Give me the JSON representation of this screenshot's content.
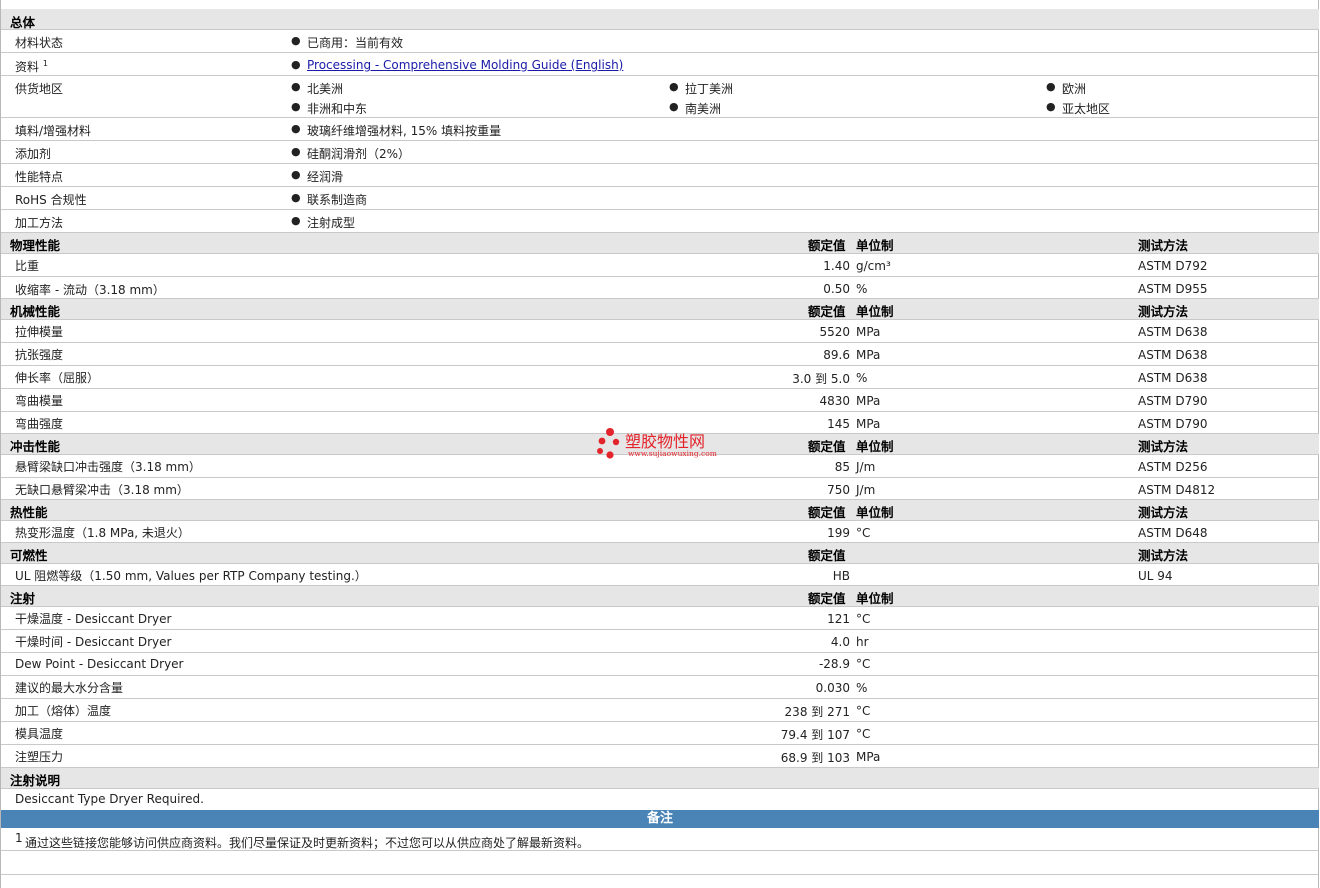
{
  "general": {
    "title": "总体",
    "status": {
      "label": "材料状态",
      "value": "已商用：当前有效"
    },
    "docs": {
      "label": "资料",
      "sup": "1",
      "link": "Processing - Comprehensive Molding Guide (English)"
    },
    "regions": {
      "label": "供货地区",
      "items": [
        "北美洲",
        "拉丁美洲",
        "欧洲",
        "非洲和中东",
        "南美洲",
        "亚太地区"
      ]
    },
    "filler": {
      "label": "填料/增强材料",
      "value": "玻璃纤维增强材料, 15% 填料按重量"
    },
    "additive": {
      "label": "添加剂",
      "value": "硅酮润滑剂（2%）"
    },
    "features": {
      "label": "性能特点",
      "value": "经润滑"
    },
    "rohs": {
      "label": "RoHS 合规性",
      "value": "联系制造商"
    },
    "processing": {
      "label": "加工方法",
      "value": "注射成型"
    }
  },
  "headers": {
    "nominal": "额定值",
    "unit": "单位制",
    "method": "测试方法"
  },
  "physical": {
    "title": "物理性能",
    "rows": [
      {
        "label": "比重",
        "value": "1.40",
        "unit": "g/cm³",
        "method": "ASTM D792"
      },
      {
        "label": "收缩率 - 流动（3.18 mm）",
        "value": "0.50",
        "unit": "%",
        "method": "ASTM D955"
      }
    ]
  },
  "mechanical": {
    "title": "机械性能",
    "rows": [
      {
        "label": "拉伸模量",
        "value": "5520",
        "unit": "MPa",
        "method": "ASTM D638"
      },
      {
        "label": "抗张强度",
        "value": "89.6",
        "unit": "MPa",
        "method": "ASTM D638"
      },
      {
        "label": "伸长率（屈服）",
        "value": "3.0 到  5.0",
        "unit": "%",
        "method": "ASTM D638"
      },
      {
        "label": "弯曲模量",
        "value": "4830",
        "unit": "MPa",
        "method": "ASTM D790"
      },
      {
        "label": "弯曲强度",
        "value": "145",
        "unit": "MPa",
        "method": "ASTM D790"
      }
    ]
  },
  "impact": {
    "title": "冲击性能",
    "rows": [
      {
        "label": "悬臂梁缺口冲击强度（3.18 mm）",
        "value": "85",
        "unit": "J/m",
        "method": "ASTM D256"
      },
      {
        "label": "无缺口悬臂梁冲击（3.18 mm）",
        "value": "750",
        "unit": "J/m",
        "method": "ASTM D4812"
      }
    ]
  },
  "thermal": {
    "title": "热性能",
    "rows": [
      {
        "label": "热变形温度（1.8 MPa, 未退火）",
        "value": "199",
        "unit": "°C",
        "method": "ASTM D648"
      }
    ]
  },
  "flammability": {
    "title": "可燃性",
    "rows": [
      {
        "label": "UL 阻燃等级（1.50 mm, Values per RTP Company testing.）",
        "value": "HB",
        "unit": "",
        "method": "UL 94"
      }
    ]
  },
  "injection": {
    "title": "注射",
    "rows": [
      {
        "label": "干燥温度 - Desiccant Dryer",
        "value": "121",
        "unit": "°C"
      },
      {
        "label": "干燥时间 - Desiccant Dryer",
        "value": "4.0",
        "unit": "hr"
      },
      {
        "label": "Dew Point - Desiccant Dryer",
        "value": "-28.9",
        "unit": "°C"
      },
      {
        "label": "建议的最大水分含量",
        "value": "0.030",
        "unit": "%"
      },
      {
        "label": "加工（熔体）温度",
        "value": "238 到  271",
        "unit": "°C"
      },
      {
        "label": "模具温度",
        "value": "79.4 到  107",
        "unit": "°C"
      },
      {
        "label": "注塑压力",
        "value": "68.9 到  103",
        "unit": "MPa"
      }
    ]
  },
  "injection_notes": {
    "title": "注射说明",
    "text": "Desiccant Type Dryer Required."
  },
  "notes": {
    "title": "备注",
    "sup": "1",
    "text": "通过这些链接您能够访问供应商资料。我们尽量保证及时更新资料；不过您可以从供应商处了解最新资料。"
  },
  "watermark": {
    "title": "塑胶物性网",
    "url": "www.sujiaowuxing.com"
  },
  "colors": {
    "section_bg": "#e6e6e6",
    "banner": "#4a84b6",
    "link": "#1a1aa8",
    "watermark": "#e4242b"
  }
}
